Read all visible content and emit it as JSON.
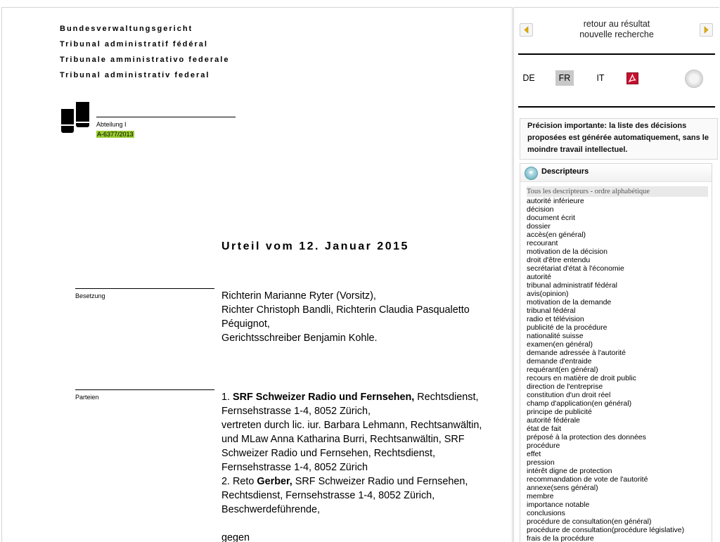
{
  "document": {
    "court_names": [
      "Bundesverwaltungsgericht",
      "Tribunal administratif fédéral",
      "Tribunale amministrativo federale",
      "Tribunal administrativ federal"
    ],
    "division": "Abteilung I",
    "case_number": "A-6377/2013",
    "title": "Urteil vom 12. Januar 2015",
    "besetzung_label": "Besetzung",
    "besetzung_lines": [
      "Richterin Marianne Ryter (Vorsitz),",
      "Richter Christoph Bandli, Richterin Claudia Pasqualetto",
      "Péquignot,",
      "Gerichtsschreiber Benjamin Kohle."
    ],
    "parteien_label": "Parteien",
    "party1_prefix": "1. ",
    "party1_name": "SRF Schweizer Radio und Fernsehen,",
    "party1_rest": " Rechtsdienst,",
    "party1_lines": [
      "Fernsehstrasse 1-4, 8052 Zürich,",
      "vertreten durch lic. iur. Barbara Lehmann, Rechtsanwältin,",
      "und MLaw Anna Katharina Burri, Rechtsanwältin, SRF",
      "Schweizer Radio und Fernsehen, Rechtsdienst,",
      "Fernsehstrasse 1-4, 8052 Zürich"
    ],
    "party2_prefix": "2. Reto ",
    "party2_name": "Gerber,",
    "party2_rest": " SRF Schweizer Radio und Fernsehen,",
    "party2_lines": [
      "Rechtsdienst, Fernsehstrasse 1-4, 8052 Zürich,",
      "Beschwerdeführende,"
    ],
    "gegen": "gegen"
  },
  "sidebar": {
    "back_link": "retour au résultat",
    "new_search_link": "nouvelle recherche",
    "languages": [
      "DE",
      "FR",
      "IT"
    ],
    "active_language": "FR",
    "notice": "Précision importante: la liste des décisions proposées est générée automatiquement, sans le moindre travail intellectuel.",
    "descriptors_title": "Descripteurs",
    "descriptors_subtitle": "Tous les descripteurs - ordre alphabétique",
    "descriptors": [
      "autorité inférieure",
      "décision",
      "document écrit",
      "dossier",
      "accès(en général)",
      "recourant",
      "motivation de la décision",
      "droit d'être entendu",
      "secrétariat d'état à l'économie",
      "autorité",
      "tribunal administratif fédéral",
      "avis(opinion)",
      "motivation de la demande",
      "tribunal fédéral",
      "radio et télévision",
      "publicité de la procédure",
      "nationalité suisse",
      "examen(en général)",
      "demande adressée à l'autorité",
      "demande d'entraide",
      "requérant(en général)",
      "recours en matière de droit public",
      "direction de l'entreprise",
      "constitution d'un droit réel",
      "champ d'application(en général)",
      "principe de publicité",
      "autorité fédérale",
      "état de fait",
      "préposé à la protection des données",
      "procédure",
      "effet",
      "pression",
      "intérêt digne de protection",
      "recommandation de vote de l'autorité",
      "annexe(sens général)",
      "membre",
      "importance notable",
      "conclusions",
      "procédure de consultation(en général)",
      "procédure de consultation(procédure législative)",
      "frais de la procédure"
    ]
  }
}
